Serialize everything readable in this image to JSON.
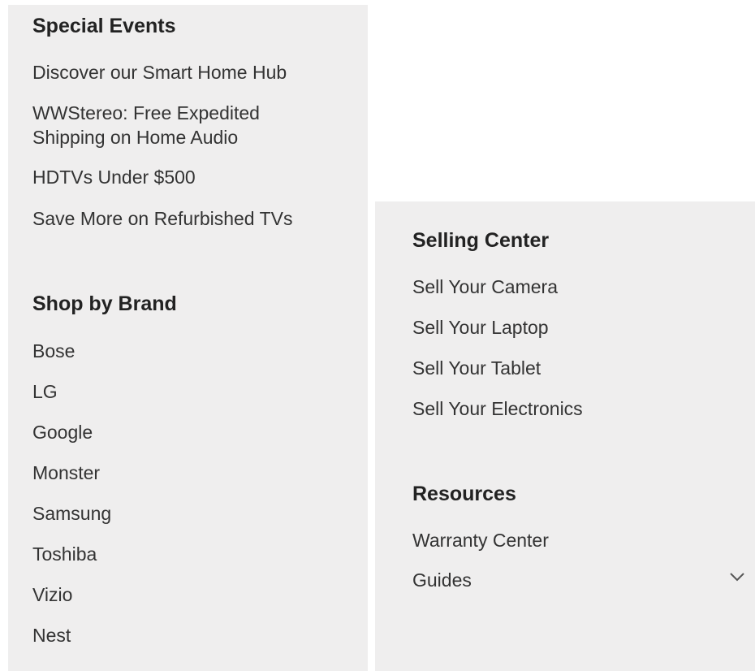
{
  "special_events": {
    "title": "Special Events",
    "items": [
      "Discover our Smart Home Hub",
      "WWStereo: Free Expedited Shipping on Home Audio",
      "HDTVs Under $500",
      "Save More on Refurbished TVs"
    ]
  },
  "shop_by_brand": {
    "title": "Shop by Brand",
    "items": [
      "Bose",
      "LG",
      "Google",
      "Monster",
      "Samsung",
      "Toshiba",
      "Vizio",
      "Nest"
    ]
  },
  "selling_center": {
    "title": "Selling Center",
    "items": [
      "Sell Your Camera",
      "Sell Your Laptop",
      "Sell Your Tablet",
      "Sell Your Electronics"
    ]
  },
  "resources": {
    "title": "Resources",
    "items": [
      "Warranty Center",
      "Guides"
    ],
    "expand_icon": "chevron-down-icon"
  },
  "colors": {
    "panel_bg": "#efeeee",
    "heading_text": "#222222",
    "link_text": "#333333"
  }
}
